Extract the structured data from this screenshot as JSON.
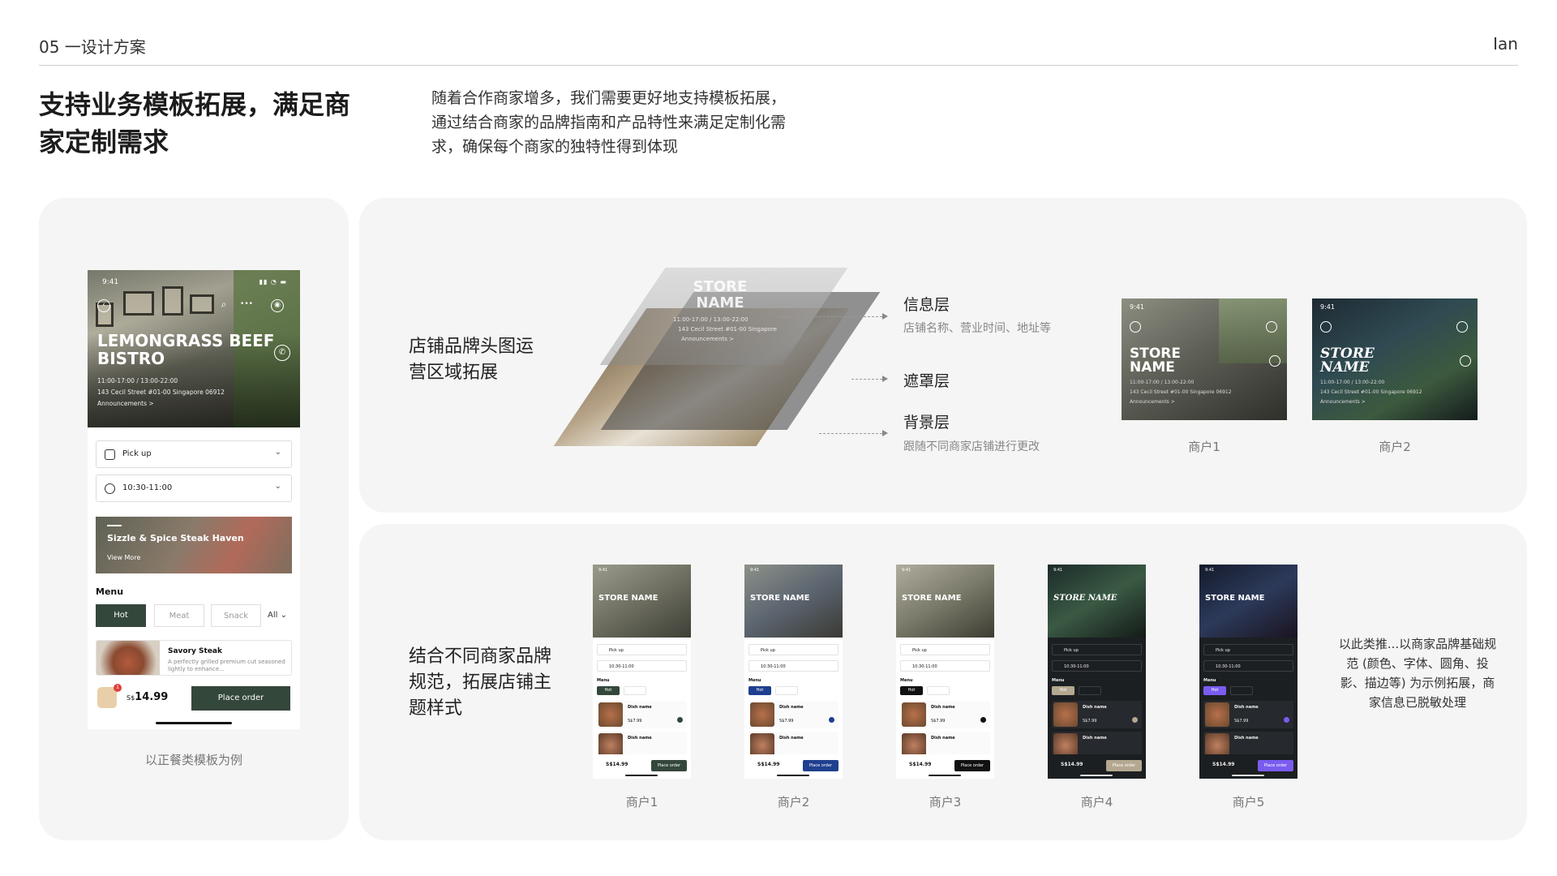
{
  "header": {
    "section_label": "05 一设计方案",
    "author": "Ian"
  },
  "intro": {
    "title": "支持业务模板拓展，满足商家定制需求",
    "description": "随着合作商家增多，我们需要更好地支持模板拓展，通过结合商家的品牌指南和产品特性来满足定制化需求，确保每个商家的独特性得到体现"
  },
  "example_phone": {
    "status_time": "9:41",
    "store_name": "LEMONGRASS BEEF BISTRO",
    "hours": "11:00-17:00 / 13:00-22:00",
    "address": "143 Cecil Street #01-00 Singapore 06912",
    "announcements": "Announcements >",
    "pickup_label": "Pick up",
    "time_label": "10:30-11:00",
    "banner_title": "Sizzle & Spice Steak Haven",
    "banner_link": "View More",
    "menu_label": "Menu",
    "tabs": [
      "Hot",
      "Meat",
      "Snack"
    ],
    "all_label": "All",
    "item_name": "Savory Steak",
    "item_desc": "A perfectly grilled premium cut seasoned lightly to enhance...",
    "cart_count": "1",
    "currency": "S$",
    "price": "14.99",
    "order_button": "Place order",
    "accent_color": "#34473b"
  },
  "left_caption": "以正餐类模板为例",
  "header_section": {
    "title": "店铺品牌头图运营区域拓展",
    "layer_store_name": "STORE NAME",
    "layer_hours": "11:00-17:00 / 13:00-22:00",
    "layer_address": "143 Cecil Street #01-00 Singapore",
    "layer_announcements": "Announcements >",
    "layers": [
      {
        "name": "信息层",
        "desc": "店铺名称、营业时间、地址等"
      },
      {
        "name": "遮罩层",
        "desc": ""
      },
      {
        "name": "背景层",
        "desc": "跟随不同商家店铺进行更改"
      }
    ],
    "merchants": [
      {
        "label": "商户1",
        "store_name": "STORE NAME",
        "status": "9:41"
      },
      {
        "label": "商户2",
        "store_name": "STORE NAME",
        "status": "9:41"
      }
    ],
    "hero_hours": "11:00-17:00 / 13:00-22:00",
    "hero_address": "143 Cecil Street #01-00 Singapore 06912",
    "hero_announcements": "Announcements >"
  },
  "theme_section": {
    "title": "结合不同商家品牌规范，拓展店铺主题样式",
    "phones": [
      {
        "label": "商户1",
        "store_name": "STORE NAME",
        "accent": "#34473b",
        "dark": false
      },
      {
        "label": "商户2",
        "store_name": "STORE NAME",
        "accent": "#1f3f8f",
        "dark": false
      },
      {
        "label": "商户3",
        "store_name": "STORE NAME",
        "accent": "#111111",
        "dark": false
      },
      {
        "label": "商户4",
        "store_name": "STORE NAME",
        "accent": "#b4a890",
        "dark": true
      },
      {
        "label": "商户5",
        "store_name": "STORE NAME",
        "accent": "#7a5cf0",
        "dark": true
      }
    ],
    "mini": {
      "pickup": "Pick up",
      "time": "10:30-11:00",
      "menu": "Menu",
      "dish": "Dish name",
      "price": "S$7.99",
      "total": "S$14.99",
      "order": "Place order"
    },
    "etc_text": "以此类推...以商家品牌基础规范 (颜色、字体、圆角、投影、描边等) 为示例拓展，商家信息已脱敏处理"
  }
}
